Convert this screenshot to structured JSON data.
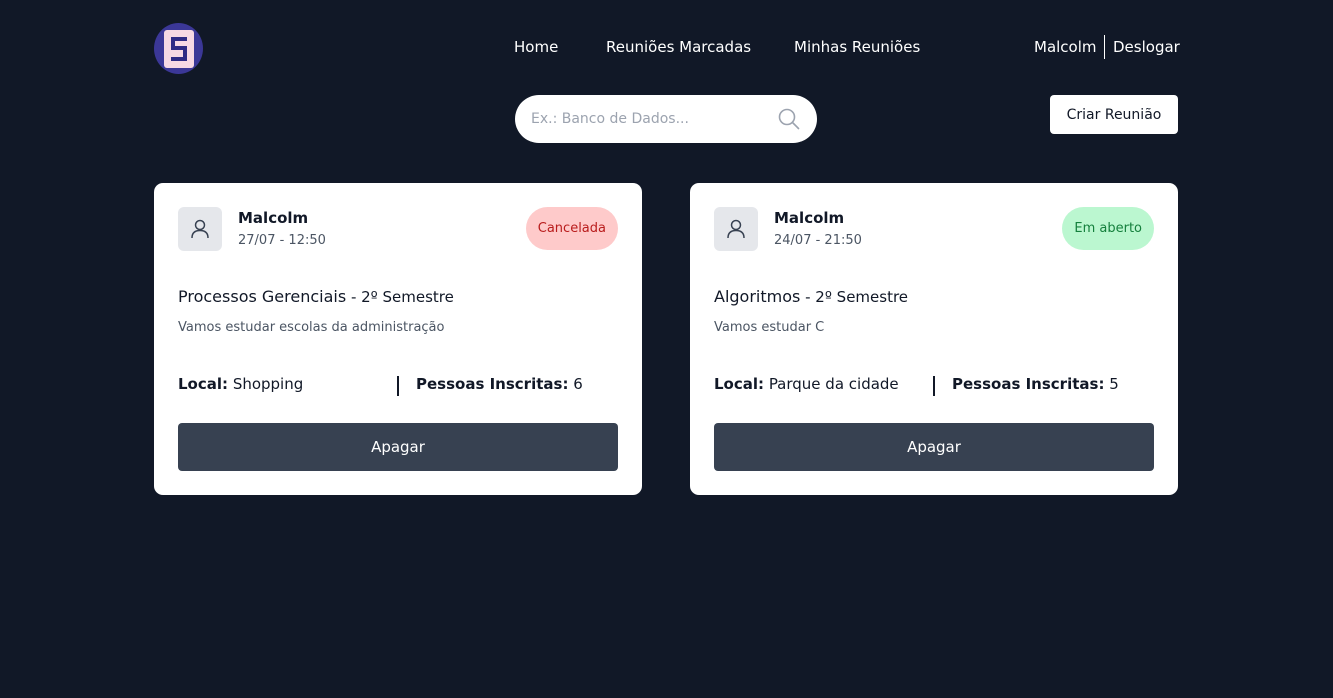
{
  "header": {
    "logo_icon": "logo-s-icon",
    "nav": {
      "home": "Home",
      "scheduled": "Reuniões Marcadas",
      "mine": "Minhas Reuniões"
    },
    "user": {
      "name": "Malcolm",
      "logout": "Deslogar"
    }
  },
  "search": {
    "placeholder": "Ex.: Banco de Dados...",
    "value": "",
    "icon": "search-icon"
  },
  "actions": {
    "create": "Criar Reunião"
  },
  "colors": {
    "background": "#111827",
    "card": "#ffffff",
    "button": "#374151",
    "badge_cancel_bg": "#fecaca",
    "badge_cancel_text": "#b91c1c",
    "badge_open_bg": "#bbf7d0",
    "badge_open_text": "#15803d"
  },
  "labels": {
    "local": "Local:",
    "people": "Pessoas Inscritas:"
  },
  "meetings": [
    {
      "author": "Malcolm",
      "datetime": "27/07 - 12:50",
      "status": "Cancelada",
      "subject": "Processos Gerenciais",
      "semester": " - 2º Semestre",
      "description": "Vamos estudar escolas da administração",
      "place": "Shopping",
      "people": "6",
      "delete_label": "Apagar"
    },
    {
      "author": "Malcolm",
      "datetime": "24/07 - 21:50",
      "status": "Em aberto",
      "subject": "Algoritmos",
      "semester": " - 2º Semestre",
      "description": "Vamos estudar C",
      "place": "Parque da cidade",
      "people": "5",
      "delete_label": "Apagar"
    }
  ]
}
